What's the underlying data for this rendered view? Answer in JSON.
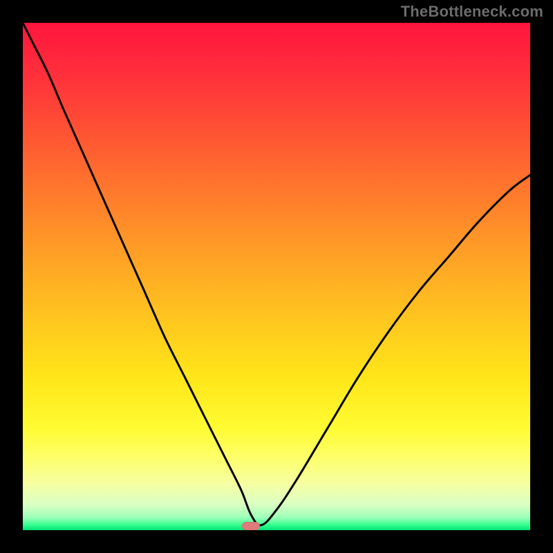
{
  "watermark": "TheBottleneck.com",
  "colors": {
    "curve_stroke": "#000000",
    "marker_fill": "#e07b7b",
    "frame_bg": "#000000"
  },
  "chart_data": {
    "type": "line",
    "title": "",
    "xlabel": "",
    "ylabel": "",
    "xlim": [
      0,
      100
    ],
    "ylim": [
      0,
      100
    ],
    "grid": false,
    "legend": false,
    "notes": "Bottleneck-style V-curve plotted over a vertical red-to-green gradient. X axis is an unlabeled normalized component ratio (0–100 left→right). Y axis is bottleneck severity (0 at bottom = balanced/green, 100 at top = severe/red). The black curve descends steeply from the top-left, reaches a minimum near x≈45, then rises more slowly toward the right edge (ending near y≈70). A small rounded salmon marker sits at the curve minimum on the baseline.",
    "series": [
      {
        "name": "bottleneck-curve",
        "x": [
          0,
          2,
          5,
          8,
          12,
          16,
          20,
          24,
          28,
          32,
          36,
          40,
          43,
          45,
          47,
          50,
          54,
          60,
          66,
          72,
          78,
          84,
          90,
          96,
          100
        ],
        "y": [
          100,
          96,
          90,
          83,
          74,
          65,
          56,
          47,
          38,
          30,
          22,
          14,
          8,
          3,
          1,
          4,
          10,
          20,
          30,
          39,
          47,
          54,
          61,
          67,
          70
        ]
      }
    ],
    "minimum_marker": {
      "x": 45,
      "y": 0
    }
  }
}
